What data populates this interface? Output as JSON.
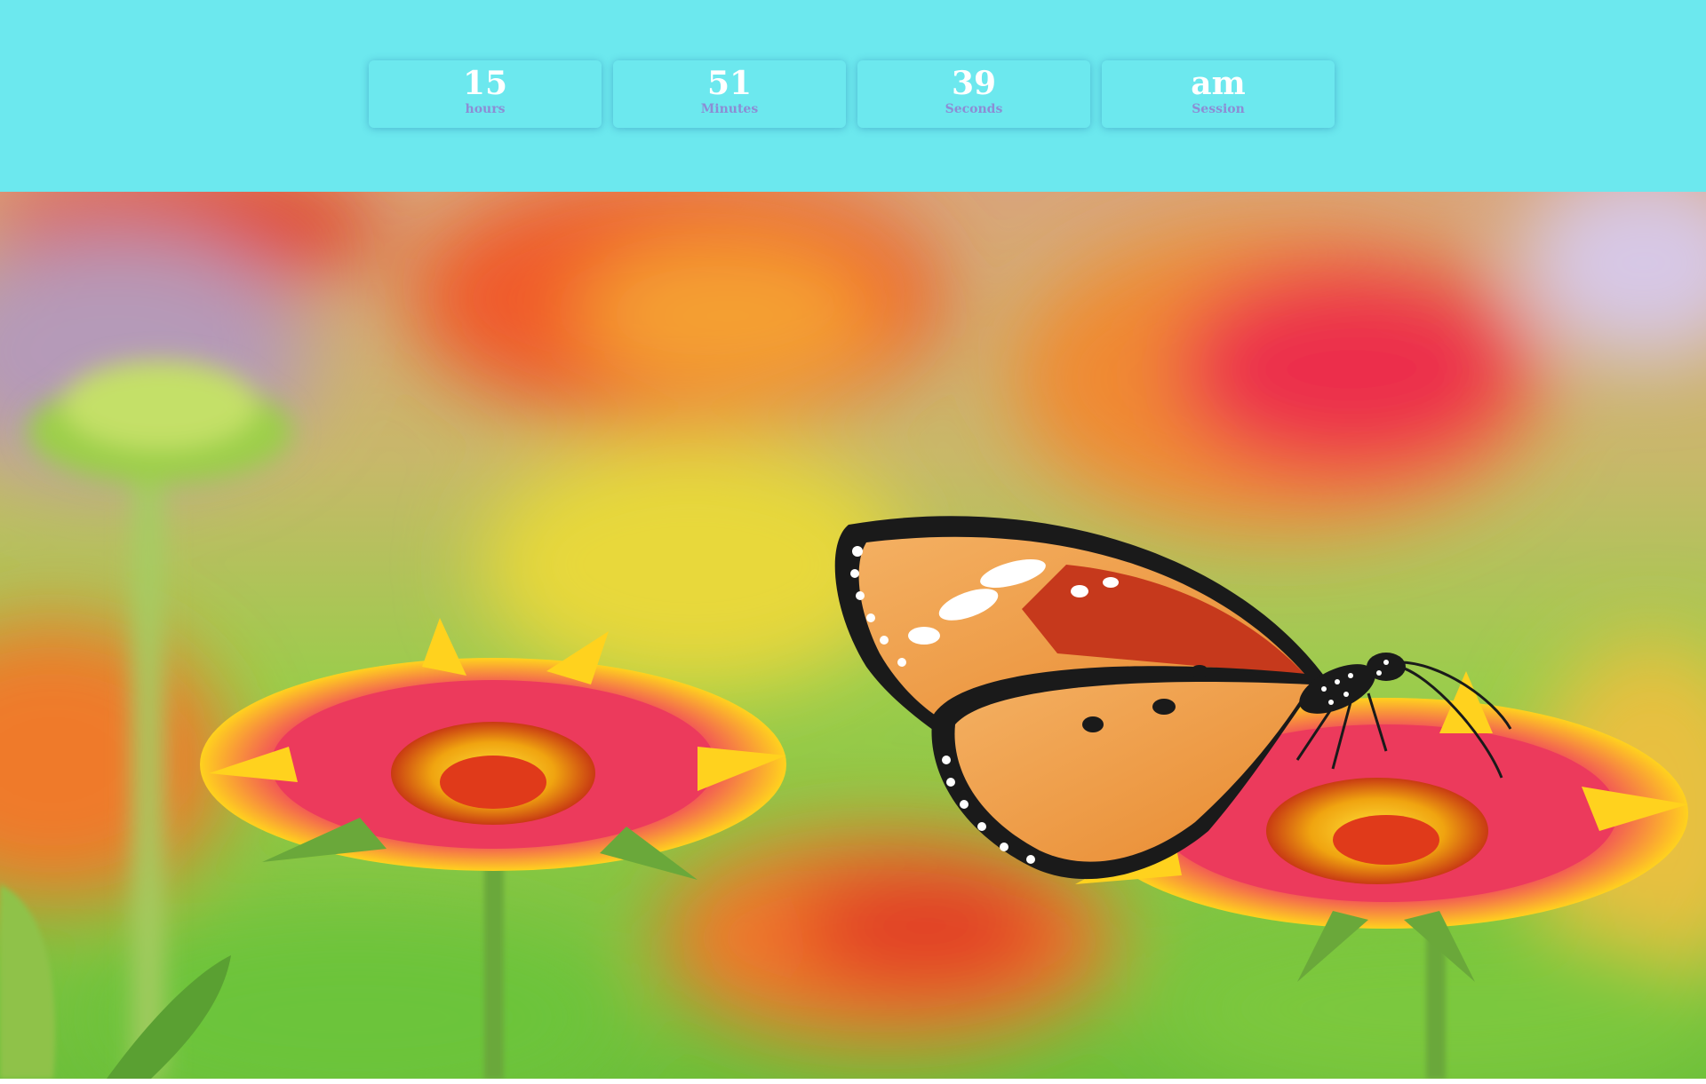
{
  "clock": {
    "hours": {
      "value": "15",
      "label": "hours"
    },
    "minutes": {
      "value": "51",
      "label": "Minutes"
    },
    "seconds": {
      "value": "39",
      "label": "Seconds"
    },
    "session": {
      "value": "am",
      "label": "Session"
    }
  },
  "colors": {
    "header_background": "#6ce8ee",
    "value_text": "#ffffff",
    "label_text": "#8c8dd4"
  },
  "background_image": {
    "subject": "butterfly-on-flowers-photo"
  }
}
